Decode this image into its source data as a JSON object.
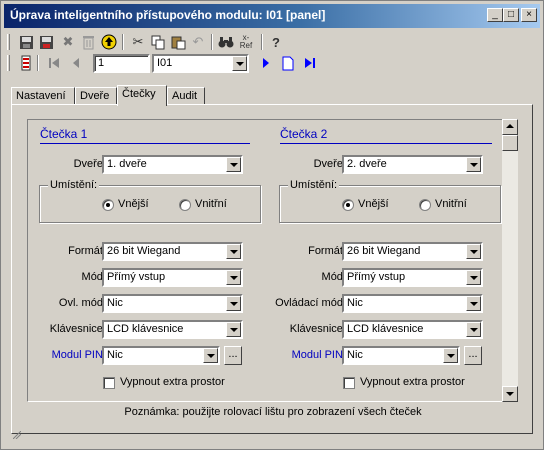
{
  "window": {
    "title": "Úprava inteligentního přístupového modulu: I01 [panel]"
  },
  "title_buttons": {
    "minimize": "_",
    "maximize": "□",
    "close": "×"
  },
  "toolbar": {
    "ref_label_top": "x-",
    "ref_label_bottom": "Ref",
    "help_glyph": "?"
  },
  "navigation": {
    "record_number": "1",
    "record_select": "I01"
  },
  "tabs": [
    "Nastavení",
    "Dveře",
    "Čtečky",
    "Audit"
  ],
  "readers": [
    {
      "title": "Čtečka 1",
      "door_label": "Dveře:",
      "door_value": "1. dveře",
      "location_group": "Umístění:",
      "location_options": [
        "Vnější",
        "Vnitřní"
      ],
      "location_selected": "Vnější",
      "format_label": "Formát:",
      "format_value": "26 bit Wiegand",
      "mode_label": "Mód:",
      "mode_value": "Přímý vstup",
      "control_mode_label": "Ovl. mód:",
      "control_mode_value": "Nic",
      "keypad_label": "Klávesnice:",
      "keypad_value": "LCD klávesnice",
      "pin_module_label": "Modul PIN:",
      "pin_module_value": "Nic",
      "browse_label": "...",
      "extra_space_label": "Vypnout extra prostor",
      "extra_space_checked": false
    },
    {
      "title": "Čtečka 2",
      "door_label": "Dveře:",
      "door_value": "2. dveře",
      "location_group": "Umístění:",
      "location_options": [
        "Vnější",
        "Vnitřní"
      ],
      "location_selected": "Vnější",
      "format_label": "Formát:",
      "format_value": "26 bit Wiegand",
      "mode_label": "Mód:",
      "mode_value": "Přímý vstup",
      "control_mode_label": "Ovládací mód:",
      "control_mode_value": "Nic",
      "keypad_label": "Klávesnice:",
      "keypad_value": "LCD klávesnice",
      "pin_module_label": "Modul PIN:",
      "pin_module_value": "Nic",
      "browse_label": "...",
      "extra_space_label": "Vypnout extra prostor",
      "extra_space_checked": false
    }
  ],
  "note": "Poznámka: použijte rolovací lištu pro zobrazení všech čteček",
  "colors": {
    "titlebar_start": "#0a246a",
    "titlebar_end": "#a6caf0",
    "window_face": "#d4d0c8",
    "link_blue": "#0000c0",
    "nav_blue": "#0000ff"
  }
}
